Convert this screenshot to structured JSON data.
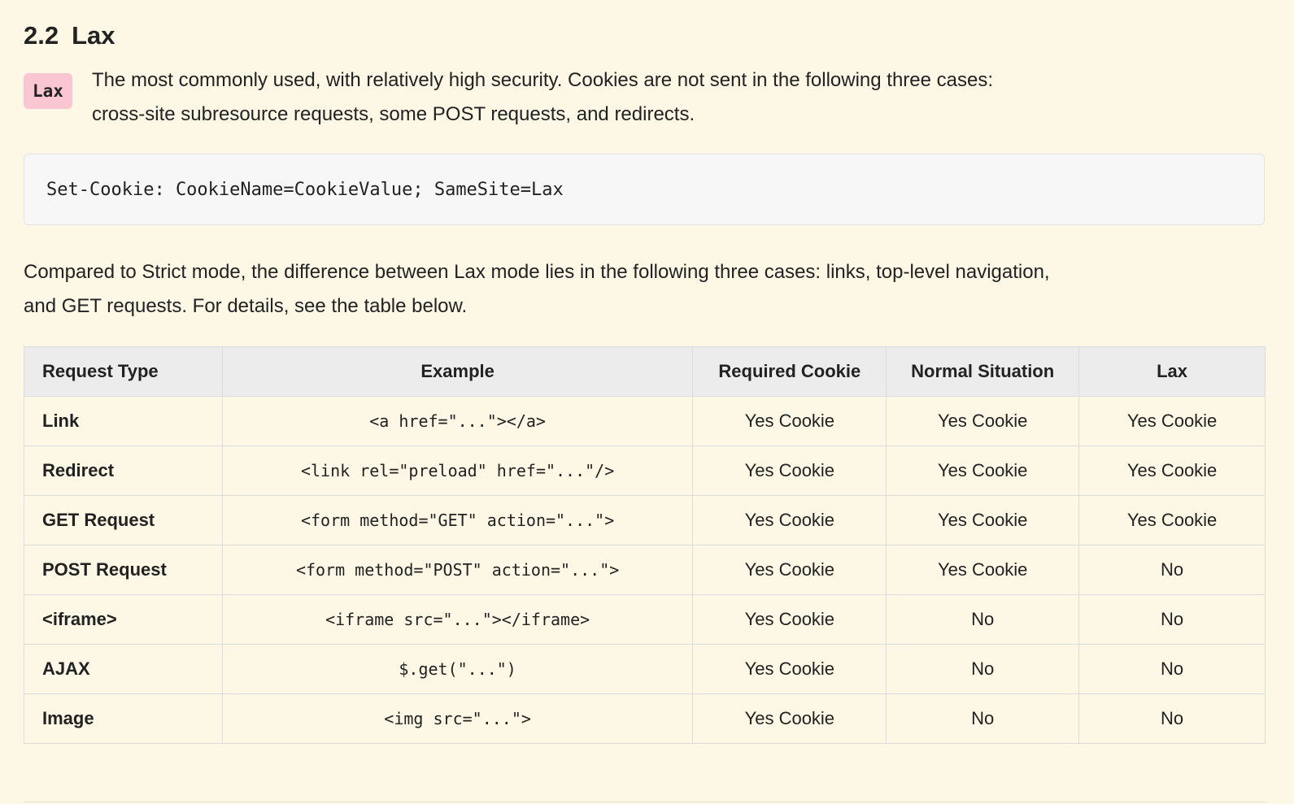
{
  "section": {
    "number": "2.2",
    "title": "Lax"
  },
  "intro": {
    "badge": "Lax",
    "line1": "The most commonly used, with relatively high security. Cookies are not sent in the following three cases:",
    "line2": "cross-site subresource requests, some POST requests, and redirects."
  },
  "code": "Set-Cookie: CookieName=CookieValue; SameSite=Lax",
  "paragraph": {
    "line1": "Compared to Strict mode, the difference between Lax mode lies in the following three cases: links, top-level navigation,",
    "line2": "and GET requests. For details, see the table below."
  },
  "table": {
    "headers": [
      "Request Type",
      "Example",
      "Required Cookie",
      "Normal Situation",
      "Lax"
    ],
    "rows": [
      [
        "Link",
        "<a href=\"...\"></a>",
        "Yes Cookie",
        "Yes Cookie",
        "Yes Cookie"
      ],
      [
        "Redirect",
        "<link rel=\"preload\" href=\"...\"/>",
        "Yes Cookie",
        "Yes Cookie",
        "Yes Cookie"
      ],
      [
        "GET Request",
        "<form method=\"GET\" action=\"...\">",
        "Yes Cookie",
        "Yes Cookie",
        "Yes Cookie"
      ],
      [
        "POST Request",
        "<form method=\"POST\" action=\"...\">",
        "Yes Cookie",
        "Yes Cookie",
        "No"
      ],
      [
        "<iframe>",
        "<iframe src=\"...\"></iframe>",
        "Yes Cookie",
        "No",
        "No"
      ],
      [
        "AJAX",
        "$.get(\"...\")",
        "Yes Cookie",
        "No",
        "No"
      ],
      [
        "Image",
        "<img src=\"...\">",
        "Yes Cookie",
        "No",
        "No"
      ]
    ]
  }
}
